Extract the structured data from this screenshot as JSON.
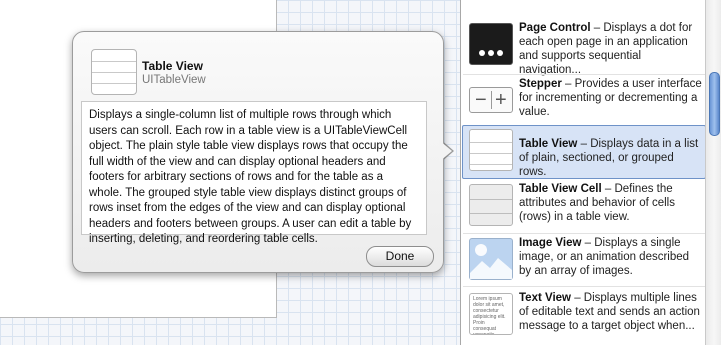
{
  "popover": {
    "title": "Table View",
    "subtitle": "UITableView",
    "description": "Displays a single-column list of multiple rows through which users can scroll. Each row in a table view is a UITableViewCell object. The plain style table view displays rows that occupy the full width of the view and can display optional headers and footers for arbitrary sections of rows and for the table as a whole. The grouped style table view displays distinct groups of rows inset from the edges of the view and can display optional headers and footers between groups. A user can edit a table by inserting, deleting, and reordering table cells.",
    "done_label": "Done"
  },
  "library": {
    "items": [
      {
        "name": "Page Control",
        "desc": "Displays a dot for each open page in an application and supports sequential navigation...",
        "icon": "page-control-icon"
      },
      {
        "name": "Stepper",
        "desc": "Provides a user interface for incrementing or decrementing a value.",
        "icon": "stepper-icon"
      },
      {
        "name": "Table View",
        "desc": "Displays data in a list of plain, sectioned, or grouped rows.",
        "icon": "table-view-icon",
        "selected": true
      },
      {
        "name": "Table View Cell",
        "desc": "Defines the attributes and behavior of cells (rows) in a table view.",
        "icon": "table-view-cell-icon"
      },
      {
        "name": "Image View",
        "desc": "Displays a single image, or an animation described by an array of images.",
        "icon": "image-view-icon"
      },
      {
        "name": "Text View",
        "desc": "Displays multiple lines of editable text and sends an action message to a target object when...",
        "icon": "text-view-icon"
      }
    ],
    "stepper_minus": "−",
    "stepper_plus": "+",
    "textview_sample": "Lorem ipsum dolor sit amet, consectetur adipisicing elit. Proin consequat venenatis luctus. Quisque et vehic"
  },
  "colors": {
    "selection_bg": "#d7e3f6",
    "selection_border": "#6e92c8",
    "scroll_thumb": "#7aa5e0"
  }
}
